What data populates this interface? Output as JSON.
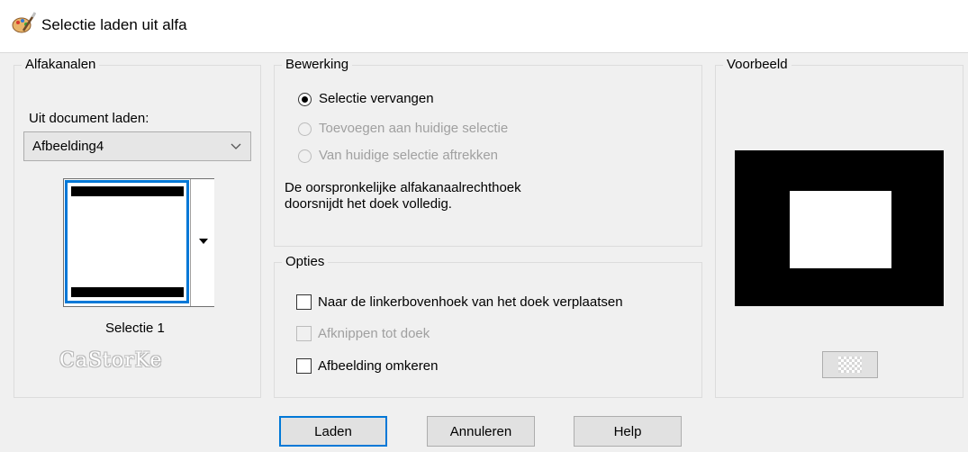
{
  "window": {
    "title": "Selectie laden uit alfa"
  },
  "alfakanalen": {
    "legend": "Alfakanalen",
    "source_label": "Uit document laden:",
    "source_value": "Afbeelding4",
    "selection_name": "Selectie 1",
    "watermark": "CaStorKe"
  },
  "bewerking": {
    "legend": "Bewerking",
    "options": [
      {
        "label": "Selectie vervangen",
        "selected": true,
        "enabled": true
      },
      {
        "label": "Toevoegen aan huidige selectie",
        "selected": false,
        "enabled": false
      },
      {
        "label": "Van huidige selectie aftrekken",
        "selected": false,
        "enabled": false
      }
    ],
    "description": "De oorspronkelijke alfakanaalrechthoek doorsnijdt het doek volledig."
  },
  "opties": {
    "legend": "Opties",
    "checkboxes": [
      {
        "label": "Naar de linkerbovenhoek van het doek verplaatsen",
        "checked": false,
        "enabled": true
      },
      {
        "label": "Afknippen tot doek",
        "checked": false,
        "enabled": false
      },
      {
        "label": "Afbeelding omkeren",
        "checked": false,
        "enabled": true
      }
    ]
  },
  "voorbeeld": {
    "legend": "Voorbeeld"
  },
  "buttons": {
    "load": "Laden",
    "cancel": "Annuleren",
    "help": "Help"
  },
  "colors": {
    "accent": "#0078d7",
    "background": "#f0f0f0",
    "disabled_text": "#a0a0a0"
  },
  "icons": {
    "app": "paint-palette-icon",
    "dropdown": "chevron-down-icon",
    "transparency": "checkerboard-icon"
  }
}
